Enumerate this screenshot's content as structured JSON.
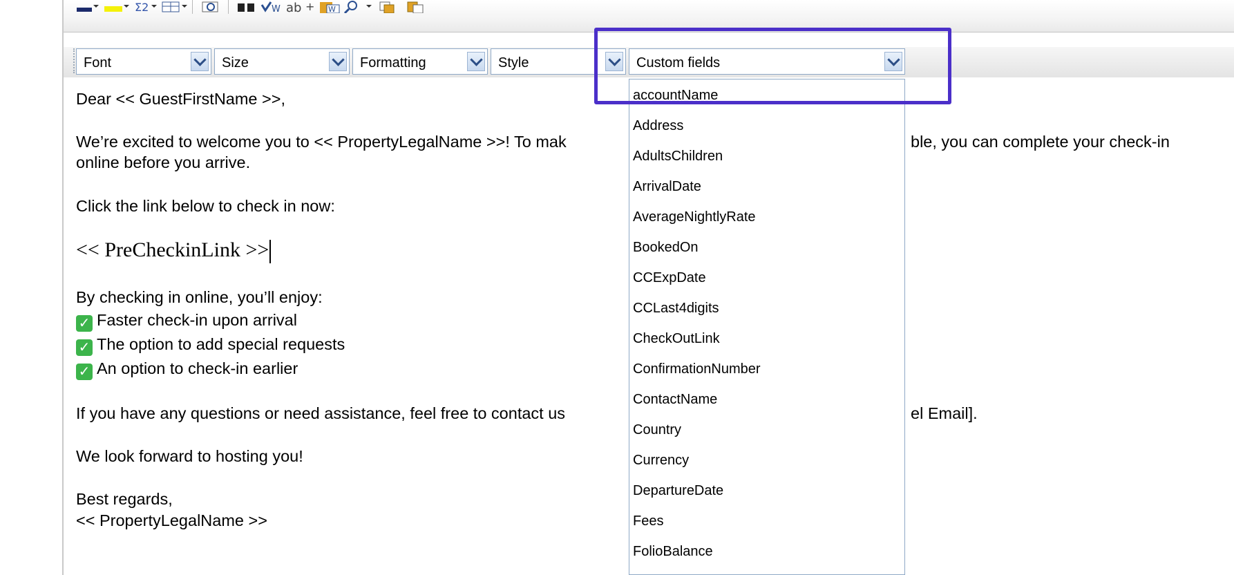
{
  "toolbar": {
    "combos": [
      {
        "label": "Font"
      },
      {
        "label": "Size"
      },
      {
        "label": "Formatting"
      },
      {
        "label": "Style"
      },
      {
        "label": "Custom fields"
      }
    ],
    "icons": [
      "font-color-icon",
      "highlight-color-icon",
      "special-chars-icon",
      "table-icon",
      "preview-icon",
      "find-icon",
      "spellcheck-icon",
      "replace-icon",
      "paste-word-icon",
      "zoom-icon",
      "copy-icon",
      "paste-icon"
    ]
  },
  "email": {
    "greeting": "Dear << GuestFirstName >>,",
    "intro_1": "We’re excited to welcome you to << PropertyLegalName >>! To mak",
    "intro_1_tail": "ble, you can complete your check-in",
    "intro_2": "online before you arrive.",
    "click_text": "Click the link below to check in now:",
    "link_token": "<< PreCheckinLink >>",
    "benefits_intro": "By checking in online, you’ll enjoy:",
    "benefits": [
      "Faster check-in upon arrival",
      "The option to add special requests",
      "An option to check-in earlier"
    ],
    "check_glyph": "✓",
    "questions": "If you have any questions or need assistance, feel free to contact us",
    "questions_tail": "el Email].",
    "closing": "We look forward to hosting you!",
    "regards": "Best regards,",
    "signature": "<< PropertyLegalName >>"
  },
  "dropdown": {
    "items": [
      "accountName",
      "Address",
      "AdultsChildren",
      "ArrivalDate",
      "AverageNightlyRate",
      "BookedOn",
      "CCExpDate",
      "CCLast4digits",
      "CheckOutLink",
      "ConfirmationNumber",
      "ContactName",
      "Country",
      "Currency",
      "DepartureDate",
      "Fees",
      "FolioBalance"
    ]
  },
  "colors": {
    "highlight_border": "#4b2fc9",
    "combo_border": "#8ea8c6",
    "check_green": "#3cb44b"
  }
}
